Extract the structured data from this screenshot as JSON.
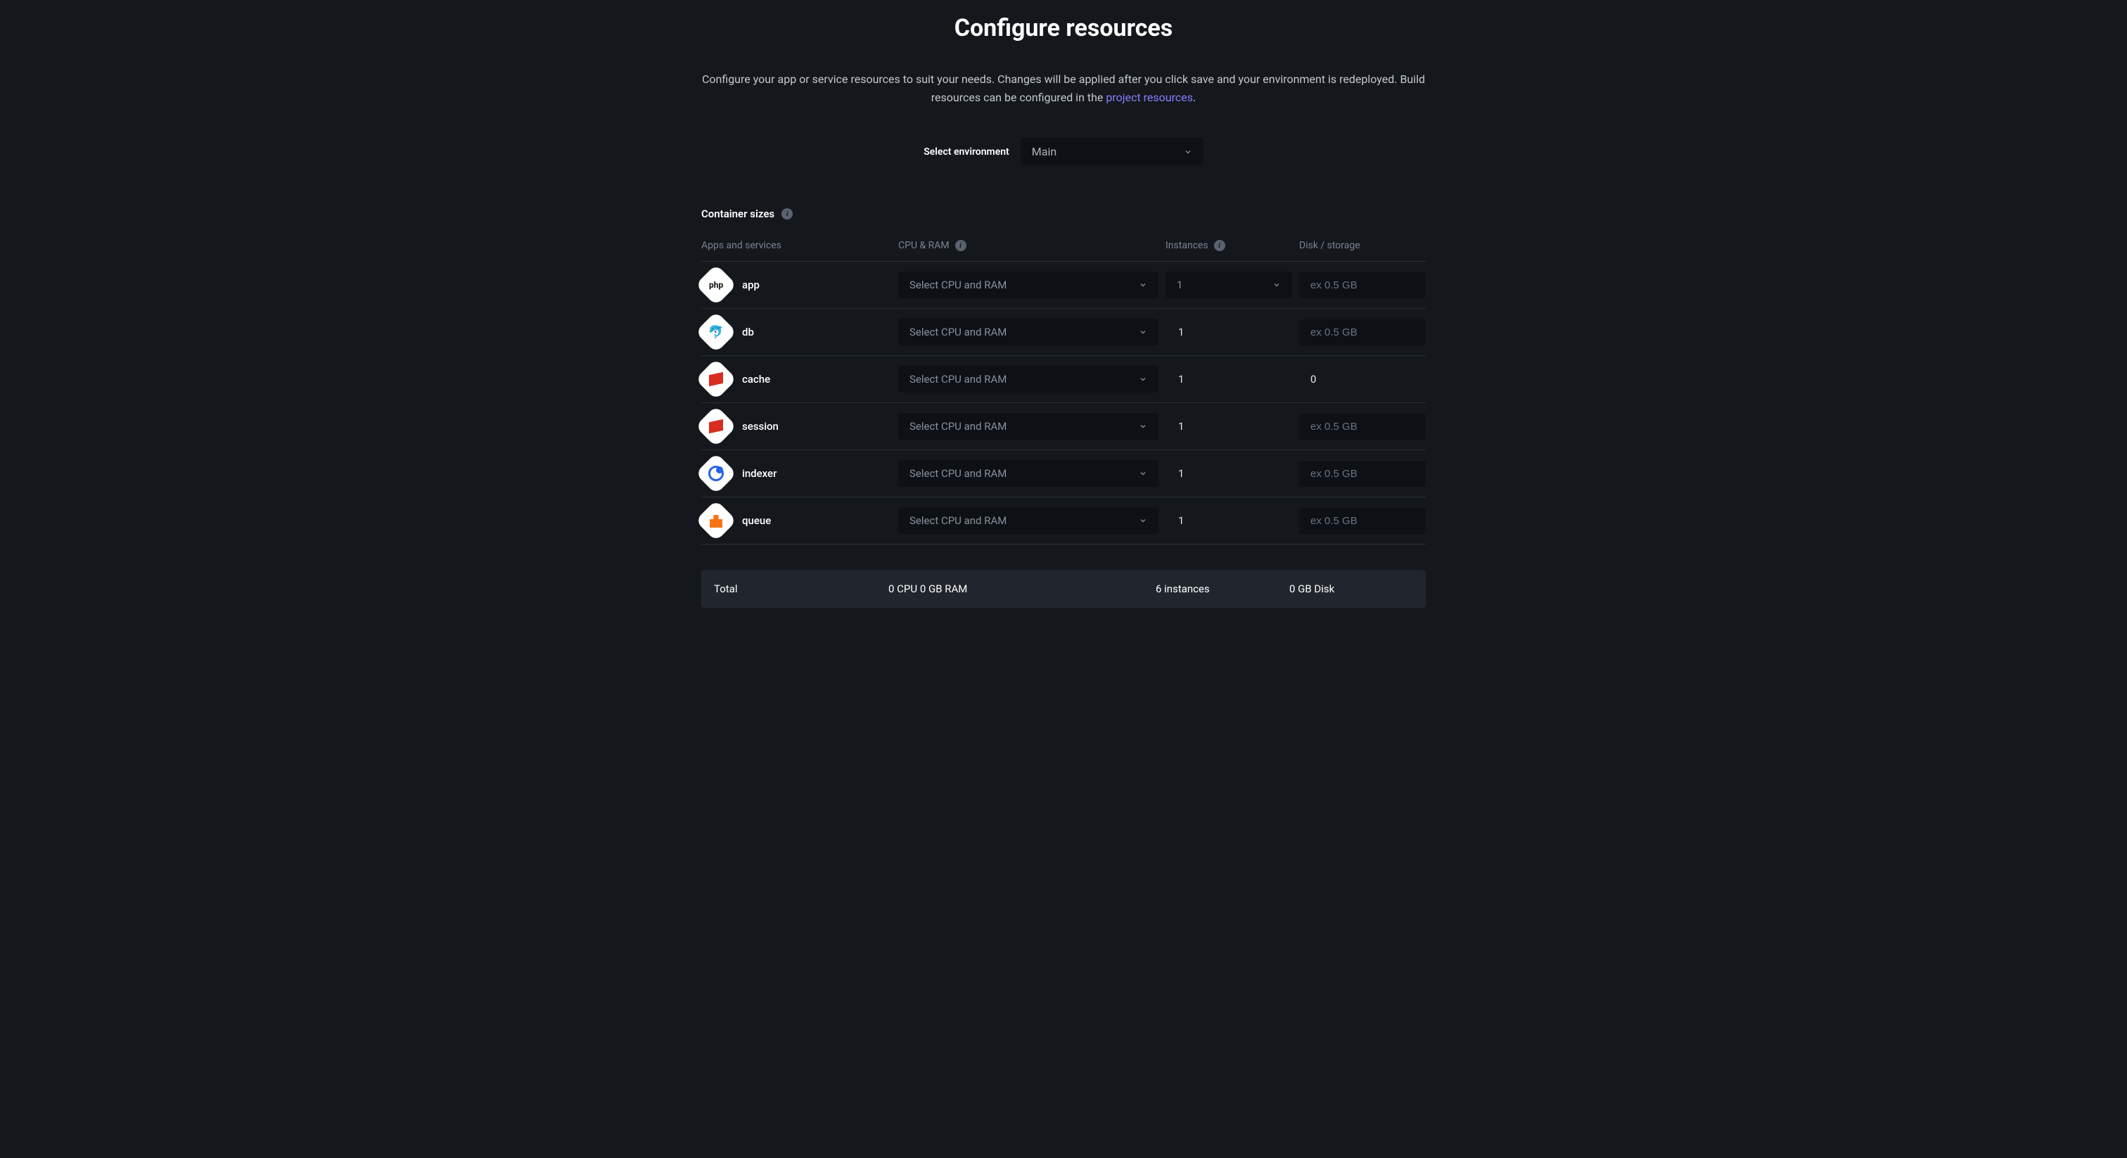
{
  "header": {
    "title": "Configure resources",
    "description_prefix": "Configure your app or service resources to suit your needs. Changes will be applied after you click save and your environment is redeployed. Build resources can be configured in the ",
    "description_link": "project resources",
    "description_suffix": "."
  },
  "environment": {
    "label": "Select environment",
    "selected": "Main"
  },
  "section": {
    "title": "Container sizes"
  },
  "columns": {
    "apps": "Apps and services",
    "cpu": "CPU & RAM",
    "instances": "Instances",
    "disk": "Disk / storage"
  },
  "cpu_placeholder": "Select CPU and RAM",
  "disk_placeholder": "ex 0.5 GB",
  "services": [
    {
      "name": "app",
      "icon": "php",
      "instances_select": true,
      "instances": "1",
      "disk_input": true
    },
    {
      "name": "db",
      "icon": "mysql",
      "instances_select": false,
      "instances": "1",
      "disk_input": true
    },
    {
      "name": "cache",
      "icon": "redis",
      "instances_select": false,
      "instances": "1",
      "disk_input": false,
      "disk_value": "0"
    },
    {
      "name": "session",
      "icon": "redis",
      "instances_select": false,
      "instances": "1",
      "disk_input": true
    },
    {
      "name": "indexer",
      "icon": "blue",
      "instances_select": false,
      "instances": "1",
      "disk_input": true
    },
    {
      "name": "queue",
      "icon": "orange",
      "instances_select": false,
      "instances": "1",
      "disk_input": true
    }
  ],
  "totals": {
    "label": "Total",
    "cpu": "0 CPU 0 GB RAM",
    "instances": "6 instances",
    "disk": "0 GB Disk"
  }
}
